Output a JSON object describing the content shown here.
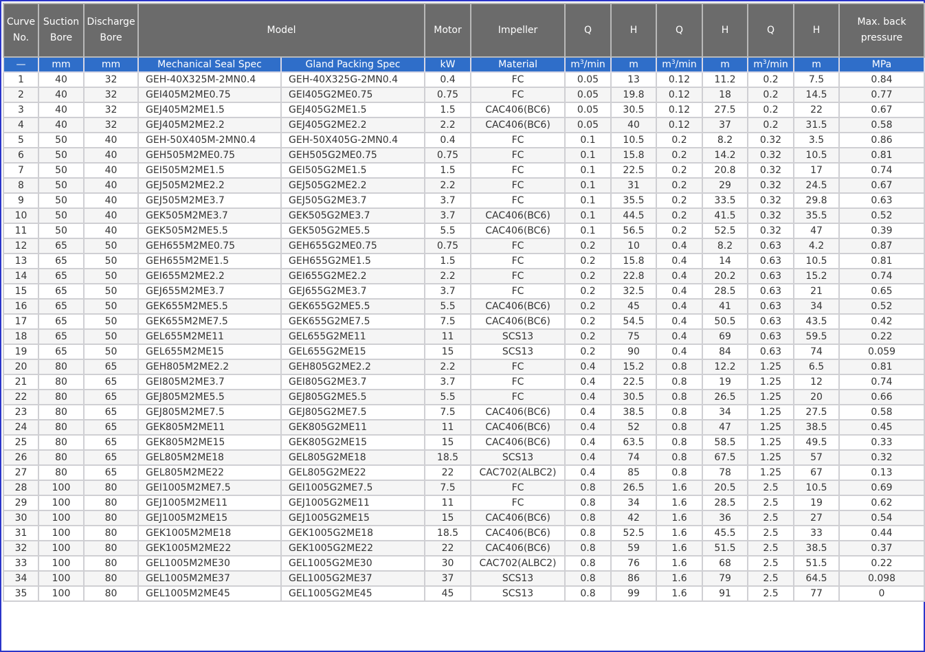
{
  "header": {
    "curve_no": "Curve\nNo.",
    "suction": "Suction\nBore",
    "discharge": "Discharge\nBore",
    "model": "Model",
    "motor": "Motor",
    "impeller": "Impeller",
    "q1": "Q",
    "h1": "H",
    "q2": "Q",
    "h2": "H",
    "q3": "Q",
    "h3": "H",
    "max_back": "Max. back\npressure"
  },
  "units": {
    "curve": "—",
    "suction": "mm",
    "discharge": "mm",
    "mech_seal": "Mechanical Seal Spec",
    "gland": "Gland Packing Spec",
    "motor": "kW",
    "impeller": "Material",
    "q1_base": "m",
    "q1_sup": "3",
    "q1_tail": "/min",
    "h1": "m",
    "q2_base": "m",
    "q2_sup": "3",
    "q2_tail": "/min",
    "h2": "m",
    "q3_base": "m",
    "q3_sup": "3",
    "q3_tail": "/min",
    "h3": "m",
    "pressure": "MPa"
  },
  "rows": [
    [
      "1",
      "40",
      "32",
      "GEH-40X325M-2MN0.4",
      "GEH-40X325G-2MN0.4",
      "0.4",
      "FC",
      "0.05",
      "13",
      "0.12",
      "11.2",
      "0.2",
      "7.5",
      "0.84"
    ],
    [
      "2",
      "40",
      "32",
      "GEI405M2ME0.75",
      "GEI405G2ME0.75",
      "0.75",
      "FC",
      "0.05",
      "19.8",
      "0.12",
      "18",
      "0.2",
      "14.5",
      "0.77"
    ],
    [
      "3",
      "40",
      "32",
      "GEJ405M2ME1.5",
      "GEJ405G2ME1.5",
      "1.5",
      "CAC406(BC6)",
      "0.05",
      "30.5",
      "0.12",
      "27.5",
      "0.2",
      "22",
      "0.67"
    ],
    [
      "4",
      "40",
      "32",
      "GEJ405M2ME2.2",
      "GEJ405G2ME2.2",
      "2.2",
      "CAC406(BC6)",
      "0.05",
      "40",
      "0.12",
      "37",
      "0.2",
      "31.5",
      "0.58"
    ],
    [
      "5",
      "50",
      "40",
      "GEH-50X405M-2MN0.4",
      "GEH-50X405G-2MN0.4",
      "0.4",
      "FC",
      "0.1",
      "10.5",
      "0.2",
      "8.2",
      "0.32",
      "3.5",
      "0.86"
    ],
    [
      "6",
      "50",
      "40",
      "GEH505M2ME0.75",
      "GEH505G2ME0.75",
      "0.75",
      "FC",
      "0.1",
      "15.8",
      "0.2",
      "14.2",
      "0.32",
      "10.5",
      "0.81"
    ],
    [
      "7",
      "50",
      "40",
      "GEI505M2ME1.5",
      "GEI505G2ME1.5",
      "1.5",
      "FC",
      "0.1",
      "22.5",
      "0.2",
      "20.8",
      "0.32",
      "17",
      "0.74"
    ],
    [
      "8",
      "50",
      "40",
      "GEJ505M2ME2.2",
      "GEJ505G2ME2.2",
      "2.2",
      "FC",
      "0.1",
      "31",
      "0.2",
      "29",
      "0.32",
      "24.5",
      "0.67"
    ],
    [
      "9",
      "50",
      "40",
      "GEJ505M2ME3.7",
      "GEJ505G2ME3.7",
      "3.7",
      "FC",
      "0.1",
      "35.5",
      "0.2",
      "33.5",
      "0.32",
      "29.8",
      "0.63"
    ],
    [
      "10",
      "50",
      "40",
      "GEK505M2ME3.7",
      "GEK505G2ME3.7",
      "3.7",
      "CAC406(BC6)",
      "0.1",
      "44.5",
      "0.2",
      "41.5",
      "0.32",
      "35.5",
      "0.52"
    ],
    [
      "11",
      "50",
      "40",
      "GEK505M2ME5.5",
      "GEK505G2ME5.5",
      "5.5",
      "CAC406(BC6)",
      "0.1",
      "56.5",
      "0.2",
      "52.5",
      "0.32",
      "47",
      "0.39"
    ],
    [
      "12",
      "65",
      "50",
      "GEH655M2ME0.75",
      "GEH655G2ME0.75",
      "0.75",
      "FC",
      "0.2",
      "10",
      "0.4",
      "8.2",
      "0.63",
      "4.2",
      "0.87"
    ],
    [
      "13",
      "65",
      "50",
      "GEH655M2ME1.5",
      "GEH655G2ME1.5",
      "1.5",
      "FC",
      "0.2",
      "15.8",
      "0.4",
      "14",
      "0.63",
      "10.5",
      "0.81"
    ],
    [
      "14",
      "65",
      "50",
      "GEI655M2ME2.2",
      "GEI655G2ME2.2",
      "2.2",
      "FC",
      "0.2",
      "22.8",
      "0.4",
      "20.2",
      "0.63",
      "15.2",
      "0.74"
    ],
    [
      "15",
      "65",
      "50",
      "GEJ655M2ME3.7",
      "GEJ655G2ME3.7",
      "3.7",
      "FC",
      "0.2",
      "32.5",
      "0.4",
      "28.5",
      "0.63",
      "21",
      "0.65"
    ],
    [
      "16",
      "65",
      "50",
      "GEK655M2ME5.5",
      "GEK655G2ME5.5",
      "5.5",
      "CAC406(BC6)",
      "0.2",
      "45",
      "0.4",
      "41",
      "0.63",
      "34",
      "0.52"
    ],
    [
      "17",
      "65",
      "50",
      "GEK655M2ME7.5",
      "GEK655G2ME7.5",
      "7.5",
      "CAC406(BC6)",
      "0.2",
      "54.5",
      "0.4",
      "50.5",
      "0.63",
      "43.5",
      "0.42"
    ],
    [
      "18",
      "65",
      "50",
      "GEL655M2ME11",
      "GEL655G2ME11",
      "11",
      "SCS13",
      "0.2",
      "75",
      "0.4",
      "69",
      "0.63",
      "59.5",
      "0.22"
    ],
    [
      "19",
      "65",
      "50",
      "GEL655M2ME15",
      "GEL655G2ME15",
      "15",
      "SCS13",
      "0.2",
      "90",
      "0.4",
      "84",
      "0.63",
      "74",
      "0.059"
    ],
    [
      "20",
      "80",
      "65",
      "GEH805M2ME2.2",
      "GEH805G2ME2.2",
      "2.2",
      "FC",
      "0.4",
      "15.2",
      "0.8",
      "12.2",
      "1.25",
      "6.5",
      "0.81"
    ],
    [
      "21",
      "80",
      "65",
      "GEI805M2ME3.7",
      "GEI805G2ME3.7",
      "3.7",
      "FC",
      "0.4",
      "22.5",
      "0.8",
      "19",
      "1.25",
      "12",
      "0.74"
    ],
    [
      "22",
      "80",
      "65",
      "GEJ805M2ME5.5",
      "GEJ805G2ME5.5",
      "5.5",
      "FC",
      "0.4",
      "30.5",
      "0.8",
      "26.5",
      "1.25",
      "20",
      "0.66"
    ],
    [
      "23",
      "80",
      "65",
      "GEJ805M2ME7.5",
      "GEJ805G2ME7.5",
      "7.5",
      "CAC406(BC6)",
      "0.4",
      "38.5",
      "0.8",
      "34",
      "1.25",
      "27.5",
      "0.58"
    ],
    [
      "24",
      "80",
      "65",
      "GEK805M2ME11",
      "GEK805G2ME11",
      "11",
      "CAC406(BC6)",
      "0.4",
      "52",
      "0.8",
      "47",
      "1.25",
      "38.5",
      "0.45"
    ],
    [
      "25",
      "80",
      "65",
      "GEK805M2ME15",
      "GEK805G2ME15",
      "15",
      "CAC406(BC6)",
      "0.4",
      "63.5",
      "0.8",
      "58.5",
      "1.25",
      "49.5",
      "0.33"
    ],
    [
      "26",
      "80",
      "65",
      "GEL805M2ME18",
      "GEL805G2ME18",
      "18.5",
      "SCS13",
      "0.4",
      "74",
      "0.8",
      "67.5",
      "1.25",
      "57",
      "0.32"
    ],
    [
      "27",
      "80",
      "65",
      "GEL805M2ME22",
      "GEL805G2ME22",
      "22",
      "CAC702(ALBC2)",
      "0.4",
      "85",
      "0.8",
      "78",
      "1.25",
      "67",
      "0.13"
    ],
    [
      "28",
      "100",
      "80",
      "GEI1005M2ME7.5",
      "GEI1005G2ME7.5",
      "7.5",
      "FC",
      "0.8",
      "26.5",
      "1.6",
      "20.5",
      "2.5",
      "10.5",
      "0.69"
    ],
    [
      "29",
      "100",
      "80",
      "GEJ1005M2ME11",
      "GEJ1005G2ME11",
      "11",
      "FC",
      "0.8",
      "34",
      "1.6",
      "28.5",
      "2.5",
      "19",
      "0.62"
    ],
    [
      "30",
      "100",
      "80",
      "GEJ1005M2ME15",
      "GEJ1005G2ME15",
      "15",
      "CAC406(BC6)",
      "0.8",
      "42",
      "1.6",
      "36",
      "2.5",
      "27",
      "0.54"
    ],
    [
      "31",
      "100",
      "80",
      "GEK1005M2ME18",
      "GEK1005G2ME18",
      "18.5",
      "CAC406(BC6)",
      "0.8",
      "52.5",
      "1.6",
      "45.5",
      "2.5",
      "33",
      "0.44"
    ],
    [
      "32",
      "100",
      "80",
      "GEK1005M2ME22",
      "GEK1005G2ME22",
      "22",
      "CAC406(BC6)",
      "0.8",
      "59",
      "1.6",
      "51.5",
      "2.5",
      "38.5",
      "0.37"
    ],
    [
      "33",
      "100",
      "80",
      "GEL1005M2ME30",
      "GEL1005G2ME30",
      "30",
      "CAC702(ALBC2)",
      "0.8",
      "76",
      "1.6",
      "68",
      "2.5",
      "51.5",
      "0.22"
    ],
    [
      "34",
      "100",
      "80",
      "GEL1005M2ME37",
      "GEL1005G2ME37",
      "37",
      "SCS13",
      "0.8",
      "86",
      "1.6",
      "79",
      "2.5",
      "64.5",
      "0.098"
    ],
    [
      "35",
      "100",
      "80",
      "GEL1005M2ME45",
      "GEL1005G2ME45",
      "45",
      "SCS13",
      "0.8",
      "99",
      "1.6",
      "91",
      "2.5",
      "77",
      "0"
    ]
  ]
}
